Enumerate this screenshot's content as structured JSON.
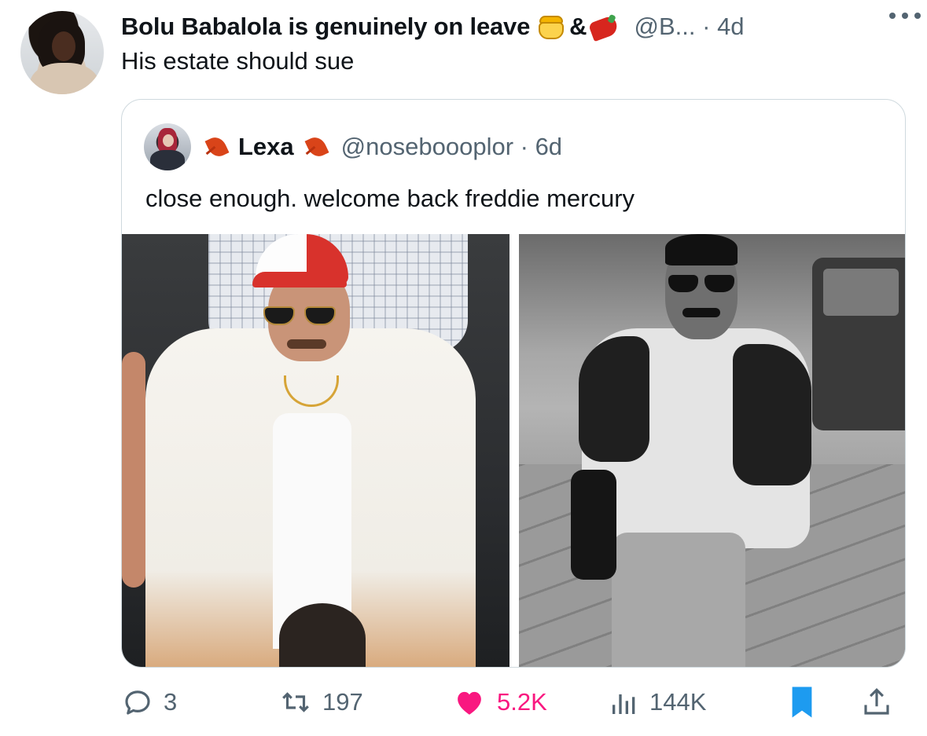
{
  "tweet": {
    "author_name": "Bolu Babalola is genuinely on leave",
    "author_name_separator": "&",
    "author_name_emojis": [
      "honey-pot-icon",
      "chili-pepper-icon"
    ],
    "handle_and_time": "@B... · 4d",
    "text": "His estate should sue"
  },
  "quote": {
    "author_name": "Lexa",
    "name_emojis": [
      "maple-leaf-icon",
      "maple-leaf-icon"
    ],
    "handle_and_time": "@noseboooplor · 6d",
    "text": "close enough. welcome back freddie mercury",
    "media": [
      {
        "name": "photo-left",
        "description_color": "color"
      },
      {
        "name": "photo-right",
        "description_color": "black-and-white"
      }
    ]
  },
  "actions": {
    "replies": "3",
    "retweets": "197",
    "likes": "5.2K",
    "views": "144K"
  },
  "colors": {
    "text_primary": "#0f1419",
    "text_secondary": "#536471",
    "like_pink": "#f91880",
    "bookmark_blue": "#1d9bf0",
    "border": "#cfd9de"
  }
}
